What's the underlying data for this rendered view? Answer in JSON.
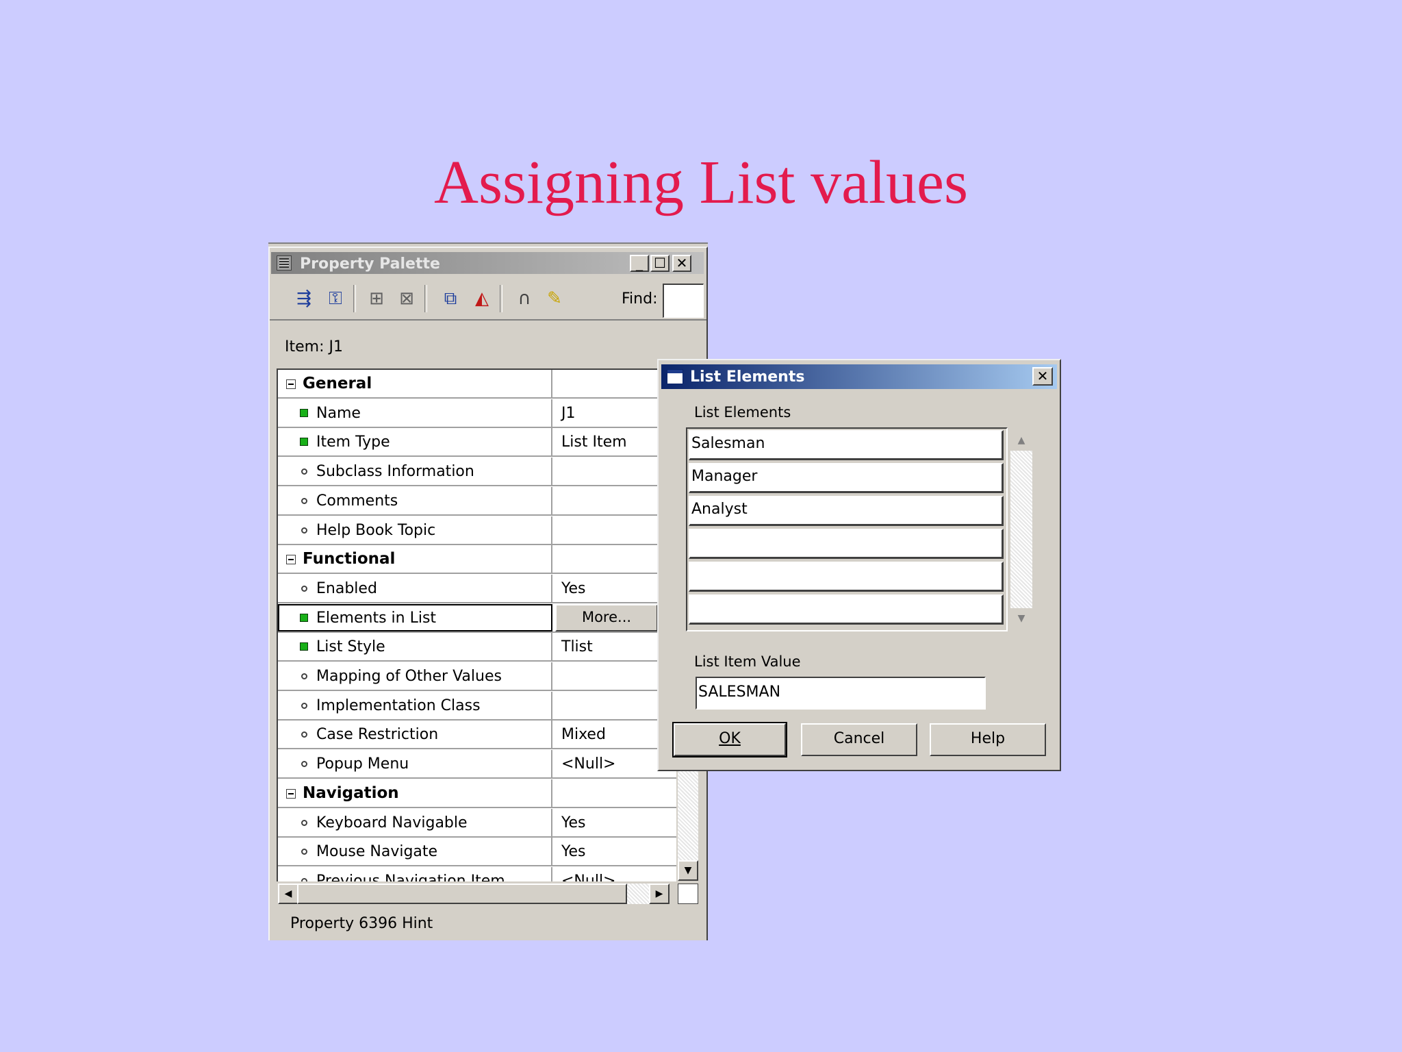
{
  "slide": {
    "title": "Assigning List values"
  },
  "palette": {
    "window_title": "Property Palette",
    "toolbar": {
      "find_label": "Find:",
      "icons": [
        "expand-icon",
        "collapse-icon",
        "add-property-icon",
        "delete-property-icon",
        "copy-icon",
        "paste-icon",
        "intersection-icon",
        "pin-icon"
      ]
    },
    "item_label": "Item: J1",
    "rows": [
      {
        "type": "category",
        "label": "General",
        "value": ""
      },
      {
        "type": "green",
        "label": "Name",
        "value": "J1"
      },
      {
        "type": "green",
        "label": "Item Type",
        "value": "List Item"
      },
      {
        "type": "circle",
        "label": "Subclass Information",
        "value": ""
      },
      {
        "type": "circle",
        "label": "Comments",
        "value": ""
      },
      {
        "type": "circle",
        "label": "Help Book Topic",
        "value": ""
      },
      {
        "type": "category",
        "label": "Functional",
        "value": ""
      },
      {
        "type": "circle",
        "label": "Enabled",
        "value": "Yes"
      },
      {
        "type": "green",
        "label": "Elements in List",
        "value": "More..."
      },
      {
        "type": "green",
        "label": "List Style",
        "value": "Tlist"
      },
      {
        "type": "circle",
        "label": "Mapping of Other Values",
        "value": ""
      },
      {
        "type": "circle",
        "label": "Implementation Class",
        "value": ""
      },
      {
        "type": "circle",
        "label": "Case Restriction",
        "value": "Mixed"
      },
      {
        "type": "circle",
        "label": "Popup Menu",
        "value": "<Null>"
      },
      {
        "type": "category",
        "label": "Navigation",
        "value": ""
      },
      {
        "type": "circle",
        "label": "Keyboard Navigable",
        "value": "Yes"
      },
      {
        "type": "circle",
        "label": "Mouse Navigate",
        "value": "Yes"
      },
      {
        "type": "circle",
        "label": "Previous Navigation Item",
        "value": "<Null>"
      }
    ],
    "status_hint": "Property 6396 Hint"
  },
  "dialog": {
    "title": "List Elements",
    "list_label": "List Elements",
    "elements": [
      "Salesman",
      "Manager",
      "Analyst",
      "",
      "",
      ""
    ],
    "value_label": "List Item Value",
    "value": "SALESMAN",
    "buttons": {
      "ok": "OK",
      "cancel": "Cancel",
      "help": "Help"
    }
  }
}
